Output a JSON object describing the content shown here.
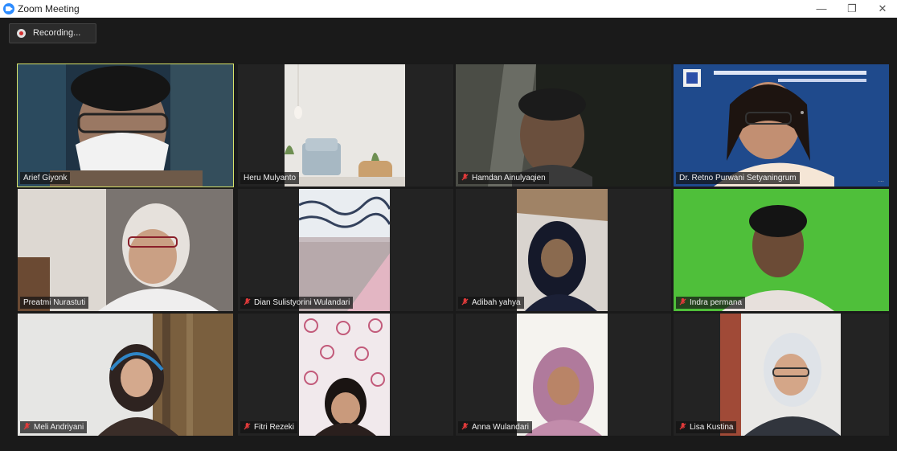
{
  "window": {
    "title": "Zoom Meeting",
    "minimize": "—",
    "restore": "❐",
    "close": "✕"
  },
  "recording": {
    "label": "Recording..."
  },
  "participants": [
    {
      "name": "Arief Giyonk",
      "muted": false
    },
    {
      "name": "Heru Mulyanto",
      "muted": false
    },
    {
      "name": "Hamdan Ainulyaqien",
      "muted": true
    },
    {
      "name": "Dr. Retno Purwani Setyaningrum",
      "muted": false
    },
    {
      "name": "Preatmi Nurastuti",
      "muted": false
    },
    {
      "name": "Dian Sulistyorini Wulandari",
      "muted": true
    },
    {
      "name": "Adibah yahya",
      "muted": true
    },
    {
      "name": "Indra permana",
      "muted": true
    },
    {
      "name": "Meli Andriyani",
      "muted": true
    },
    {
      "name": "Fitri Rezeki",
      "muted": true
    },
    {
      "name": "Anna Wulandari",
      "muted": true
    },
    {
      "name": "Lisa Kustina",
      "muted": true
    }
  ]
}
